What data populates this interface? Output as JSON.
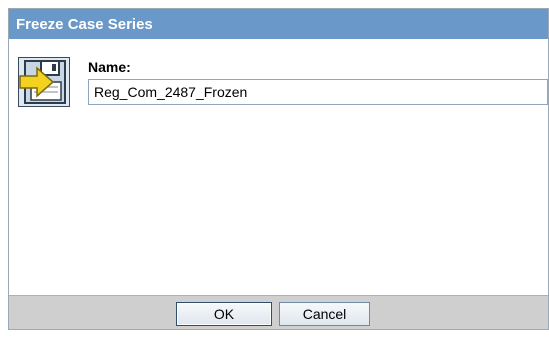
{
  "dialog": {
    "title": "Freeze Case Series",
    "icon": "freeze-case-series-icon"
  },
  "form": {
    "name_label": "Name:",
    "name_value": "Reg_Com_2487_Frozen"
  },
  "buttons": {
    "ok_label": "OK",
    "cancel_label": "Cancel"
  },
  "colors": {
    "titlebar": "#6a98c8",
    "footer": "#cfcfcf",
    "icon_arrow": "#f2d21e"
  }
}
